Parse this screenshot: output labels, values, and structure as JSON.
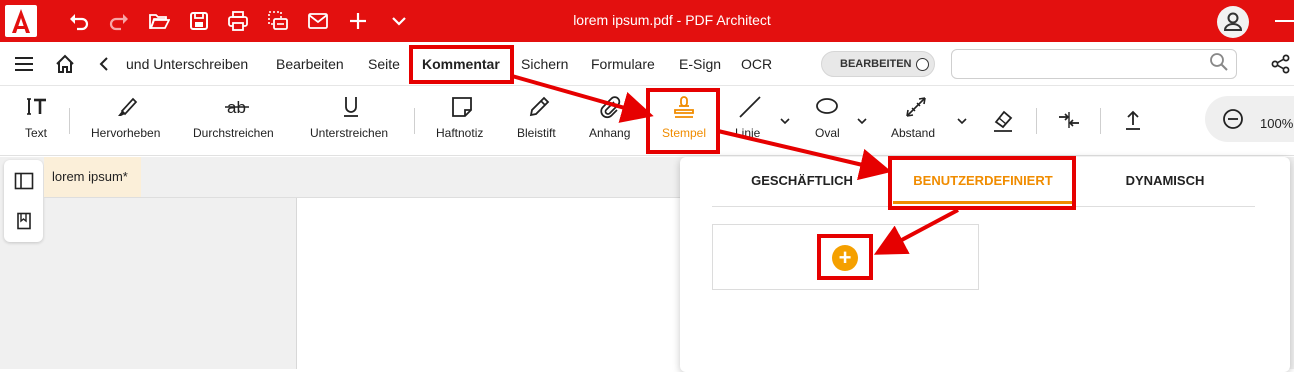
{
  "titlebar": {
    "title": "lorem ipsum.pdf  -  PDF Architect",
    "colors": {
      "background": "#e3100f",
      "text": "#ffffff"
    },
    "icons": [
      "app-logo",
      "undo-icon",
      "redo-icon",
      "open-folder-icon",
      "save-icon",
      "print-icon",
      "scan-icon",
      "mail-icon",
      "add-icon",
      "more-chevron-icon",
      "user-avatar-icon",
      "minimize-icon"
    ]
  },
  "menubar": {
    "items": [
      "und Unterschreiben",
      "Bearbeiten",
      "Seite",
      "Kommentar",
      "Sichern",
      "Formulare",
      "E-Sign",
      "OCR"
    ],
    "active": "Kommentar",
    "edit_toggle_label": "BEARBEITEN",
    "search_placeholder": ""
  },
  "ribbon": {
    "tools": [
      {
        "label": "Text",
        "icon": "text-insert-icon"
      },
      {
        "label": "Hervorheben",
        "icon": "highlighter-icon"
      },
      {
        "label": "Durchstreichen",
        "icon": "strikethrough-icon"
      },
      {
        "label": "Unterstreichen",
        "icon": "underline-icon"
      },
      {
        "label": "Haftnotiz",
        "icon": "sticky-note-icon"
      },
      {
        "label": "Bleistift",
        "icon": "pencil-icon"
      },
      {
        "label": "Anhang",
        "icon": "paperclip-icon"
      },
      {
        "label": "Stempel",
        "icon": "stamp-icon",
        "active": true
      },
      {
        "label": "Linie",
        "icon": "line-icon"
      },
      {
        "label": "Oval",
        "icon": "oval-icon"
      },
      {
        "label": "Abstand",
        "icon": "distance-icon"
      }
    ],
    "extra_icons": [
      "eraser-icon",
      "compare-icon",
      "export-icon"
    ],
    "zoom": "100%",
    "accent_color": "#f08c00"
  },
  "document": {
    "tab_label": "lorem ipsum",
    "modified_marker": "*"
  },
  "stamp_panel": {
    "tabs": [
      "GESCHÄFTLICH",
      "BENUTZERDEFINIERT",
      "DYNAMISCH"
    ],
    "active_tab": "BENUTZERDEFINIERT",
    "add_button": "+"
  },
  "annotation_color": "#e60000"
}
